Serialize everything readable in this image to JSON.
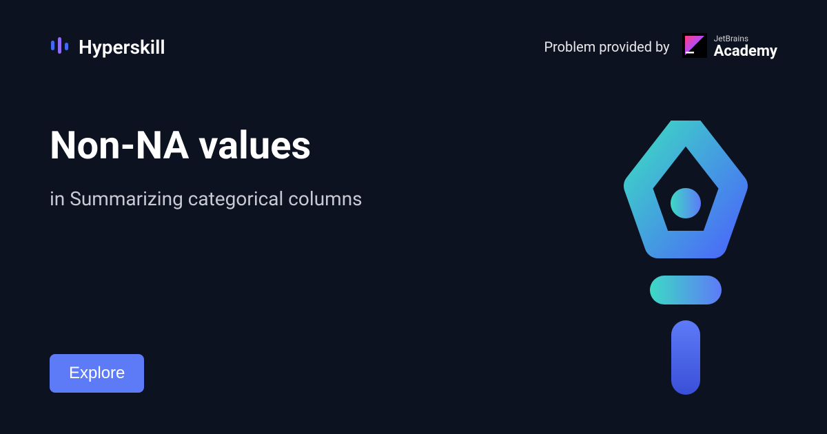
{
  "brand": {
    "name": "Hyperskill"
  },
  "provider": {
    "label": "Problem provided by",
    "jb_small": "JetBrains",
    "jb_big": "Academy"
  },
  "main": {
    "title": "Non-NA values",
    "subtitle": "in Summarizing categorical columns"
  },
  "cta": {
    "explore": "Explore"
  }
}
